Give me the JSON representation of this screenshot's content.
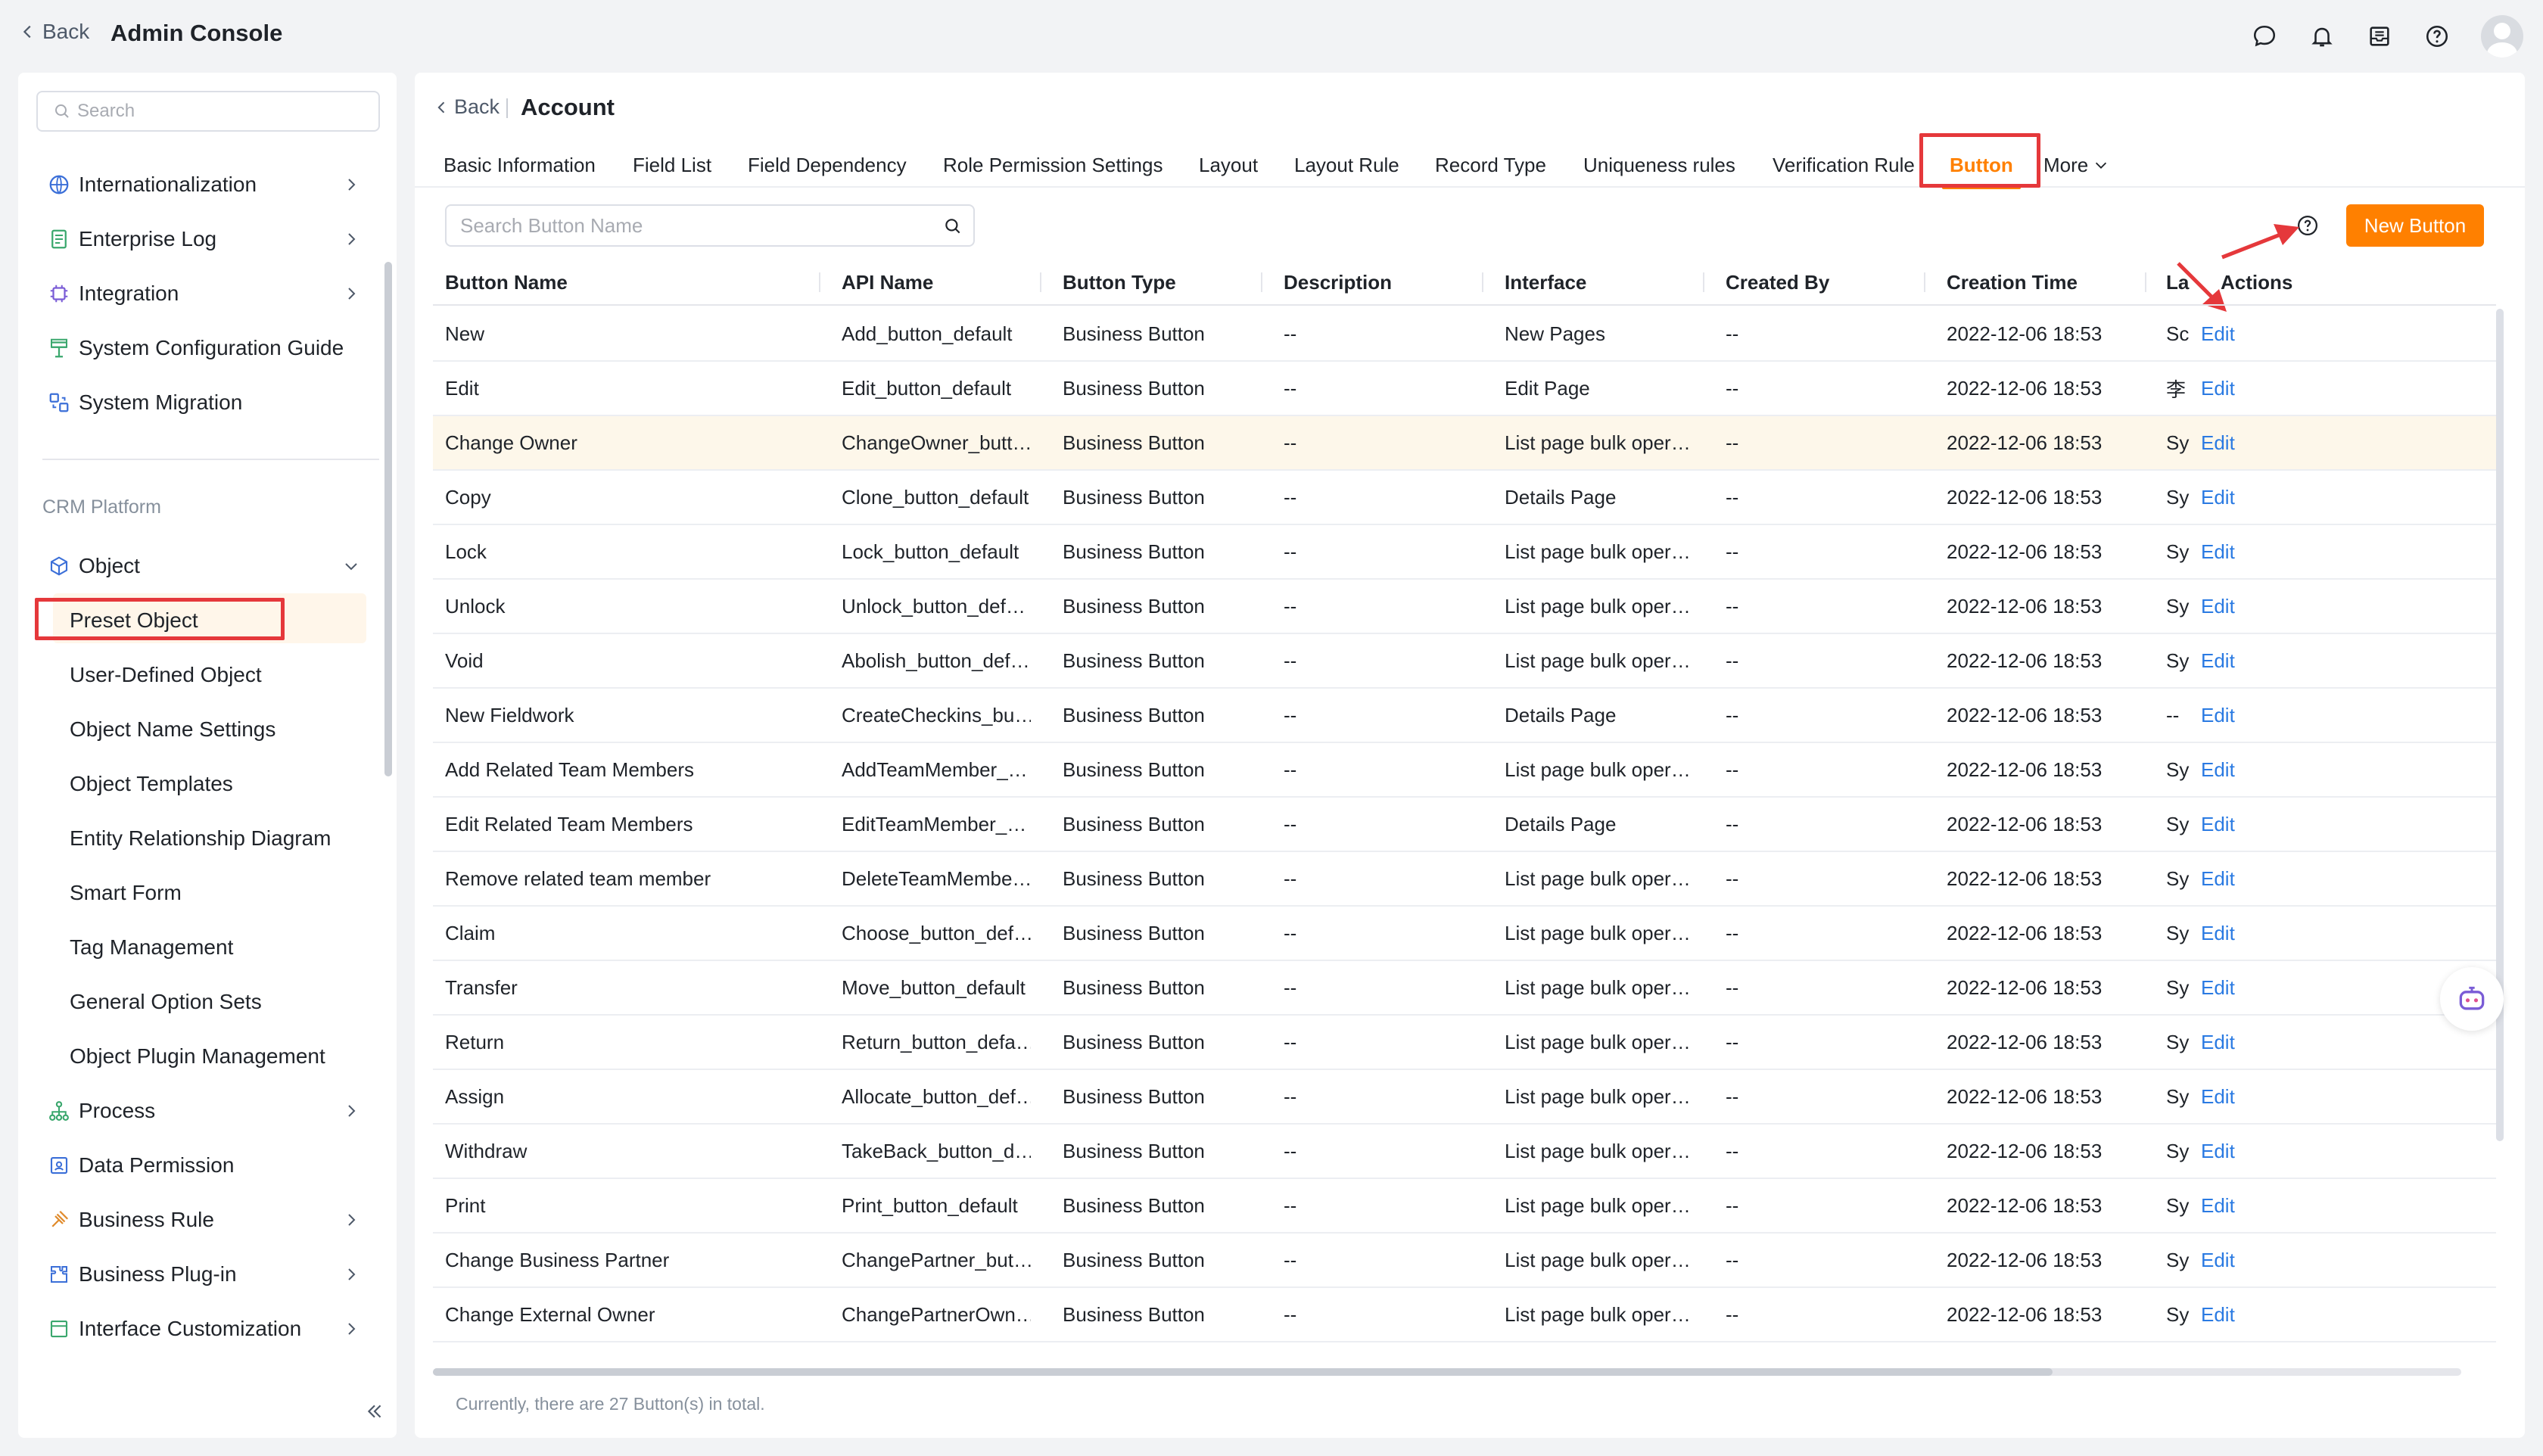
{
  "topbar": {
    "back_label": "Back",
    "title": "Admin Console",
    "icons": [
      "chat-icon",
      "bell-icon",
      "inbox-icon",
      "help-icon",
      "user-avatar"
    ]
  },
  "sidebar": {
    "search_placeholder": "Search",
    "items_top": [
      {
        "label": "Internationalization",
        "icon": "globe-icon",
        "has_chevron": true
      },
      {
        "label": "Enterprise Log",
        "icon": "log-icon",
        "has_chevron": true
      },
      {
        "label": "Integration",
        "icon": "chip-icon",
        "has_chevron": true
      },
      {
        "label": "System Configuration Guide",
        "icon": "guide-icon",
        "has_chevron": false
      },
      {
        "label": "System Migration",
        "icon": "migration-icon",
        "has_chevron": false
      }
    ],
    "group_label": "CRM Platform",
    "object": {
      "label": "Object",
      "icon": "cube-icon",
      "expanded": true
    },
    "object_children": [
      "Preset Object",
      "User-Defined Object",
      "Object Name Settings",
      "Object Templates",
      "Entity Relationship Diagram",
      "Smart Form",
      "Tag Management",
      "General Option Sets",
      "Object Plugin Management"
    ],
    "selected_child": "Preset Object",
    "items_bottom": [
      {
        "label": "Process",
        "icon": "process-icon",
        "has_chevron": true
      },
      {
        "label": "Data Permission",
        "icon": "permission-icon",
        "has_chevron": false
      },
      {
        "label": "Business Rule",
        "icon": "rule-icon",
        "has_chevron": true
      },
      {
        "label": "Business Plug-in",
        "icon": "plugin-icon",
        "has_chevron": true
      },
      {
        "label": "Interface Customization",
        "icon": "layout-icon",
        "has_chevron": true
      }
    ]
  },
  "main": {
    "back_label": "Back",
    "title": "Account",
    "tabs": [
      "Basic Information",
      "Field List",
      "Field Dependency",
      "Role Permission Settings",
      "Layout",
      "Layout Rule",
      "Record Type",
      "Uniqueness rules",
      "Verification Rule",
      "Button",
      "More"
    ],
    "active_tab": "Button",
    "search_placeholder": "Search Button Name",
    "new_button_label": "New Button",
    "columns": [
      "Button Name",
      "API Name",
      "Button Type",
      "Description",
      "Interface",
      "Created By",
      "Creation Time",
      "La",
      "Actions"
    ],
    "rows": [
      {
        "name": "New",
        "api": "Add_button_default",
        "type": "Business Button",
        "desc": "--",
        "iface": "New Pages",
        "created_by": "--",
        "time": "2022-12-06 18:53",
        "last": "Sc",
        "action": "Edit"
      },
      {
        "name": "Edit",
        "api": "Edit_button_default",
        "type": "Business Button",
        "desc": "--",
        "iface": "Edit Page",
        "created_by": "--",
        "time": "2022-12-06 18:53",
        "last": "李",
        "action": "Edit"
      },
      {
        "name": "Change Owner",
        "api": "ChangeOwner_butt…",
        "type": "Business Button",
        "desc": "--",
        "iface": "List page bulk oper…",
        "created_by": "--",
        "time": "2022-12-06 18:53",
        "last": "Sy",
        "action": "Edit"
      },
      {
        "name": "Copy",
        "api": "Clone_button_default",
        "type": "Business Button",
        "desc": "--",
        "iface": "Details Page",
        "created_by": "--",
        "time": "2022-12-06 18:53",
        "last": "Sy",
        "action": "Edit"
      },
      {
        "name": "Lock",
        "api": "Lock_button_default",
        "type": "Business Button",
        "desc": "--",
        "iface": "List page bulk oper…",
        "created_by": "--",
        "time": "2022-12-06 18:53",
        "last": "Sy",
        "action": "Edit"
      },
      {
        "name": "Unlock",
        "api": "Unlock_button_def…",
        "type": "Business Button",
        "desc": "--",
        "iface": "List page bulk oper…",
        "created_by": "--",
        "time": "2022-12-06 18:53",
        "last": "Sy",
        "action": "Edit"
      },
      {
        "name": "Void",
        "api": "Abolish_button_def…",
        "type": "Business Button",
        "desc": "--",
        "iface": "List page bulk oper…",
        "created_by": "--",
        "time": "2022-12-06 18:53",
        "last": "Sy",
        "action": "Edit"
      },
      {
        "name": "New Fieldwork",
        "api": "CreateCheckins_bu…",
        "type": "Business Button",
        "desc": "--",
        "iface": "Details Page",
        "created_by": "--",
        "time": "2022-12-06 18:53",
        "last": "--",
        "action": "Edit"
      },
      {
        "name": "Add Related Team Members",
        "api": "AddTeamMember_…",
        "type": "Business Button",
        "desc": "--",
        "iface": "List page bulk oper…",
        "created_by": "--",
        "time": "2022-12-06 18:53",
        "last": "Sy",
        "action": "Edit"
      },
      {
        "name": "Edit Related Team Members",
        "api": "EditTeamMember_…",
        "type": "Business Button",
        "desc": "--",
        "iface": "Details Page",
        "created_by": "--",
        "time": "2022-12-06 18:53",
        "last": "Sy",
        "action": "Edit"
      },
      {
        "name": "Remove related team member",
        "api": "DeleteTeamMembe…",
        "type": "Business Button",
        "desc": "--",
        "iface": "List page bulk oper…",
        "created_by": "--",
        "time": "2022-12-06 18:53",
        "last": "Sy",
        "action": "Edit"
      },
      {
        "name": "Claim",
        "api": "Choose_button_def…",
        "type": "Business Button",
        "desc": "--",
        "iface": "List page bulk oper…",
        "created_by": "--",
        "time": "2022-12-06 18:53",
        "last": "Sy",
        "action": "Edit"
      },
      {
        "name": "Transfer",
        "api": "Move_button_default",
        "type": "Business Button",
        "desc": "--",
        "iface": "List page bulk oper…",
        "created_by": "--",
        "time": "2022-12-06 18:53",
        "last": "Sy",
        "action": "Edit"
      },
      {
        "name": "Return",
        "api": "Return_button_defa…",
        "type": "Business Button",
        "desc": "--",
        "iface": "List page bulk oper…",
        "created_by": "--",
        "time": "2022-12-06 18:53",
        "last": "Sy",
        "action": "Edit"
      },
      {
        "name": "Assign",
        "api": "Allocate_button_def…",
        "type": "Business Button",
        "desc": "--",
        "iface": "List page bulk oper…",
        "created_by": "--",
        "time": "2022-12-06 18:53",
        "last": "Sy",
        "action": "Edit"
      },
      {
        "name": "Withdraw",
        "api": "TakeBack_button_d…",
        "type": "Business Button",
        "desc": "--",
        "iface": "List page bulk oper…",
        "created_by": "--",
        "time": "2022-12-06 18:53",
        "last": "Sy",
        "action": "Edit"
      },
      {
        "name": "Print",
        "api": "Print_button_default",
        "type": "Business Button",
        "desc": "--",
        "iface": "List page bulk oper…",
        "created_by": "--",
        "time": "2022-12-06 18:53",
        "last": "Sy",
        "action": "Edit"
      },
      {
        "name": "Change Business Partner",
        "api": "ChangePartner_but…",
        "type": "Business Button",
        "desc": "--",
        "iface": "List page bulk oper…",
        "created_by": "--",
        "time": "2022-12-06 18:53",
        "last": "Sy",
        "action": "Edit"
      },
      {
        "name": "Change External Owner",
        "api": "ChangePartnerOwn…",
        "type": "Business Button",
        "desc": "--",
        "iface": "List page bulk oper…",
        "created_by": "--",
        "time": "2022-12-06 18:53",
        "last": "Sy",
        "action": "Edit"
      }
    ],
    "highlighted_row": "Change Owner",
    "footer": "Currently, there are 27 Button(s) in total."
  },
  "colors": {
    "accent": "#ff8000",
    "link": "#2a7ae2",
    "annotation_red": "#e5383b",
    "row_highlight": "#fdf7ea"
  }
}
